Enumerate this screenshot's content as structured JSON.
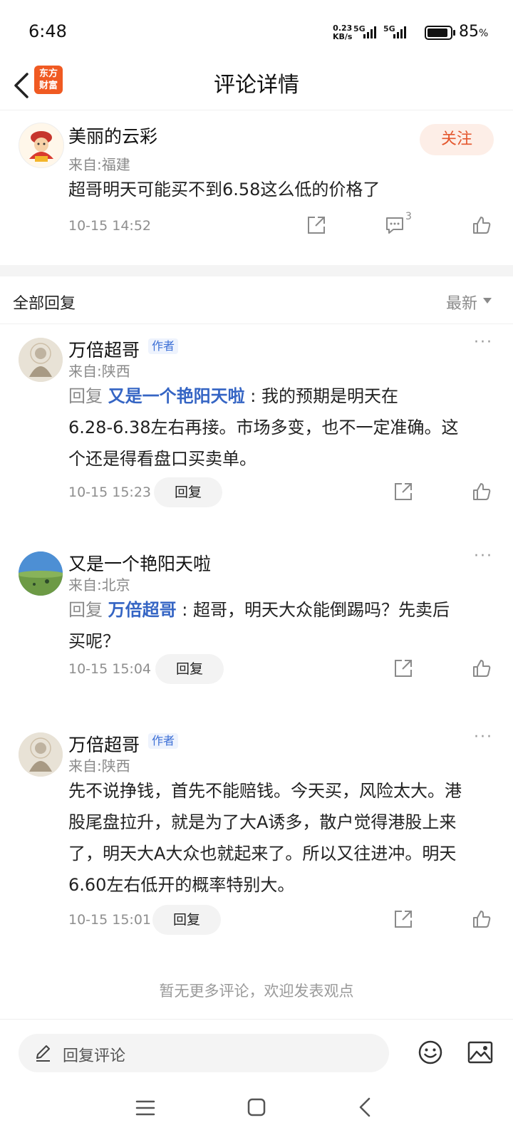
{
  "status": {
    "time": "6:48",
    "net_speed_value": "0.23",
    "net_speed_unit": "KB/s",
    "signal1_label": "5G",
    "signal2_label": "5G",
    "battery_value": "85",
    "battery_unit": "%"
  },
  "header": {
    "logo_line1": "东方",
    "logo_line2": "财富",
    "title": "评论详情"
  },
  "main_comment": {
    "name": "美丽的云彩",
    "region": "来自:福建",
    "text": "超哥明天可能买不到6.58这么低的价格了",
    "timestamp": "10-15 14:52",
    "comment_count": "3",
    "follow_label": "关注"
  },
  "replies_header": {
    "label": "全部回复",
    "sort": "最新"
  },
  "replies": [
    {
      "name": "万倍超哥",
      "tag": "作者",
      "region": "来自:陕西",
      "prefix": "回复",
      "mention": "又是一个艳阳天啦",
      "line1_rest": ": 我的预期是明天在",
      "line2": "6.28-6.38左右再接。市场多变，也不一定准确。这",
      "line3": "个还是得看盘口买卖单。",
      "timestamp": "10-15 15:23",
      "reply_label": "回复"
    },
    {
      "name": "又是一个艳阳天啦",
      "region": "来自:北京",
      "prefix": "回复",
      "mention": "万倍超哥",
      "line1_rest": ": 超哥，明天大众能倒踢吗？先卖后",
      "line2": "买呢？",
      "timestamp": "10-15 15:04",
      "reply_label": "回复"
    },
    {
      "name": "万倍超哥",
      "tag": "作者",
      "region": "来自:陕西",
      "line1": "先不说挣钱，首先不能赔钱。今天买，风险太大。港",
      "line2": "股尾盘拉升，就是为了大A诱多，散户觉得港股上来",
      "line3": "了，明天大A大众也就起来了。所以又往进冲。明天",
      "line4": "6.60左右低开的概率特别大。",
      "timestamp": "10-15 15:01",
      "reply_label": "回复"
    }
  ],
  "no_more": "暂无更多评论，欢迎发表观点",
  "bottom_bar": {
    "placeholder": "回复评论"
  },
  "more_label": "···"
}
